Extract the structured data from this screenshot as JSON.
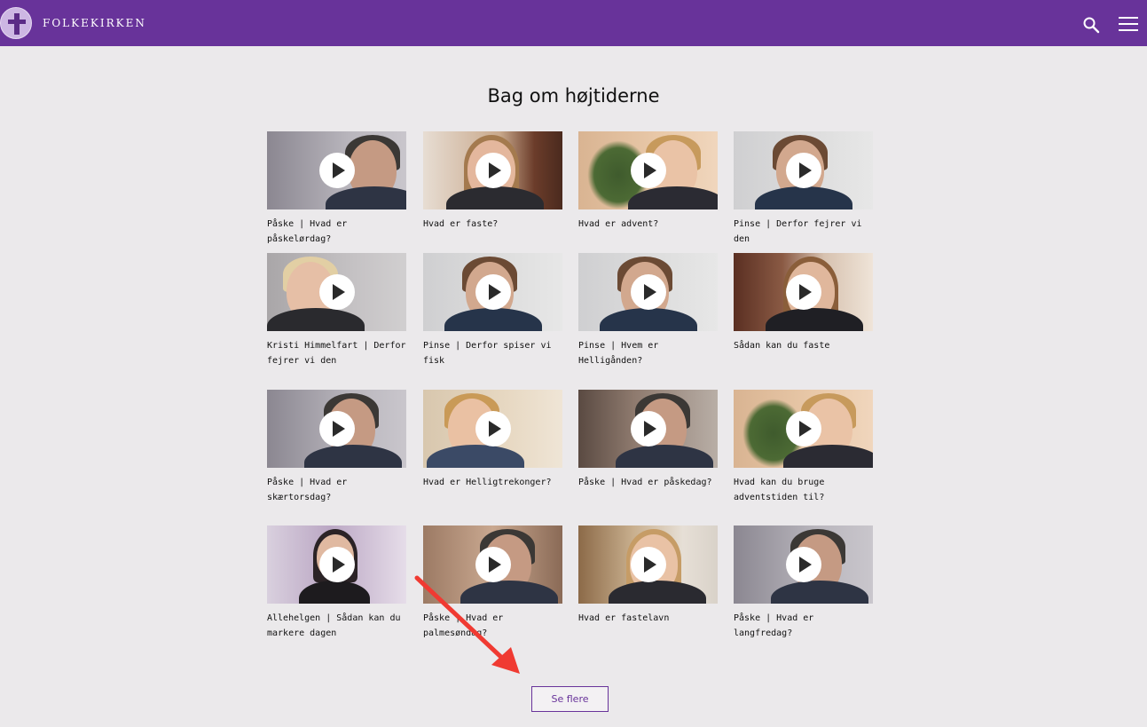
{
  "header": {
    "brand": "FOLKEKIRKEN",
    "background": "#68339a"
  },
  "section": {
    "title": "Bag om højtiderne"
  },
  "videos": [
    {
      "caption": "Påske | Hvad er påskelørdag?"
    },
    {
      "caption": "Hvad er faste?"
    },
    {
      "caption": "Hvad er advent?"
    },
    {
      "caption": "Pinse | Derfor fejrer vi den"
    },
    {
      "caption": "Kristi Himmelfart | Derfor fejrer vi den"
    },
    {
      "caption": "Pinse | Derfor spiser vi fisk"
    },
    {
      "caption": "Pinse | Hvem er Helligånden?"
    },
    {
      "caption": "Sådan kan du faste"
    },
    {
      "caption": "Påske | Hvad er skærtorsdag?"
    },
    {
      "caption": "Hvad er Helligtrekonger?"
    },
    {
      "caption": "Påske | Hvad er påskedag?"
    },
    {
      "caption": "Hvad kan du bruge adventstiden til?"
    },
    {
      "caption": "Allehelgen | Sådan kan du markere dagen"
    },
    {
      "caption": "Påske | Hvad er palmesøndag?"
    },
    {
      "caption": "Hvad er fastelavn"
    },
    {
      "caption": "Påske | Hvad er langfredag?"
    }
  ],
  "more_button": {
    "label": "Se flere"
  },
  "annotation": {
    "arrow_color": "#f03a32"
  }
}
